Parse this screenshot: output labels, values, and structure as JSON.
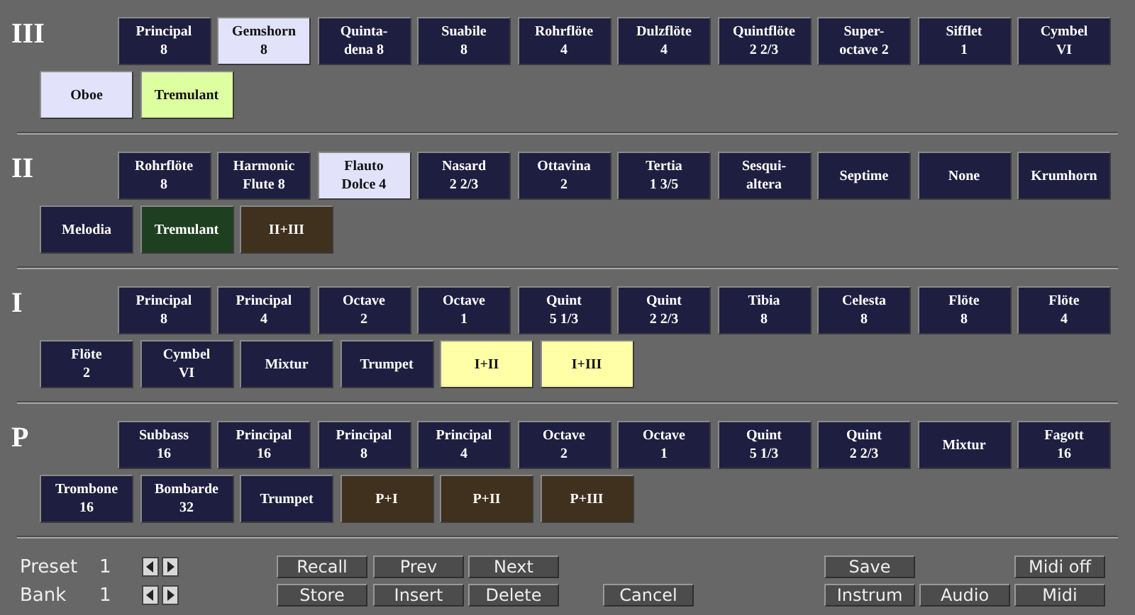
{
  "divisions": [
    {
      "name": "III",
      "stops": [
        {
          "kind": "stop",
          "label": "Principal\n8",
          "on": false
        },
        {
          "kind": "stop",
          "label": "Gemshorn\n8",
          "on": true
        },
        {
          "kind": "stop",
          "label": "Quinta-\ndena 8",
          "on": false
        },
        {
          "kind": "stop",
          "label": "Suabile\n8",
          "on": false
        },
        {
          "kind": "stop",
          "label": "Rohrflöte\n4",
          "on": false
        },
        {
          "kind": "stop",
          "label": "Dulzflöte\n4",
          "on": false
        },
        {
          "kind": "stop",
          "label": "Quintflöte\n2 2/3",
          "on": false
        },
        {
          "kind": "stop",
          "label": "Super-\noctave 2",
          "on": false
        },
        {
          "kind": "stop",
          "label": "Sifflet\n1",
          "on": false
        },
        {
          "kind": "stop",
          "label": "Cymbel\nVI",
          "on": false
        },
        {
          "kind": "stop",
          "label": "Oboe",
          "on": true
        },
        {
          "kind": "tremulant",
          "label": "Tremulant",
          "on": true
        }
      ]
    },
    {
      "name": "II",
      "stops": [
        {
          "kind": "stop",
          "label": "Rohrflöte\n8",
          "on": false
        },
        {
          "kind": "stop",
          "label": "Harmonic\nFlute 8",
          "on": false
        },
        {
          "kind": "stop",
          "label": "Flauto\nDolce 4",
          "on": true
        },
        {
          "kind": "stop",
          "label": "Nasard\n2 2/3",
          "on": false
        },
        {
          "kind": "stop",
          "label": "Ottavina\n2",
          "on": false
        },
        {
          "kind": "stop",
          "label": "Tertia\n1 3/5",
          "on": false
        },
        {
          "kind": "stop",
          "label": "Sesqui-\naltera",
          "on": false
        },
        {
          "kind": "stop",
          "label": "Septime",
          "on": false
        },
        {
          "kind": "stop",
          "label": "None",
          "on": false
        },
        {
          "kind": "stop",
          "label": "Krumhorn",
          "on": false
        },
        {
          "kind": "stop",
          "label": "Melodia",
          "on": false
        },
        {
          "kind": "tremulant",
          "label": "Tremulant",
          "on": false
        },
        {
          "kind": "coupler",
          "label": "II+III",
          "on": false
        }
      ]
    },
    {
      "name": "I",
      "stops": [
        {
          "kind": "stop",
          "label": "Principal\n8",
          "on": false
        },
        {
          "kind": "stop",
          "label": "Principal\n4",
          "on": false
        },
        {
          "kind": "stop",
          "label": "Octave\n2",
          "on": false
        },
        {
          "kind": "stop",
          "label": "Octave\n1",
          "on": false
        },
        {
          "kind": "stop",
          "label": "Quint\n5 1/3",
          "on": false
        },
        {
          "kind": "stop",
          "label": "Quint\n2 2/3",
          "on": false
        },
        {
          "kind": "stop",
          "label": "Tibia\n8",
          "on": false
        },
        {
          "kind": "stop",
          "label": "Celesta\n8",
          "on": false
        },
        {
          "kind": "stop",
          "label": "Flöte\n8",
          "on": false
        },
        {
          "kind": "stop",
          "label": "Flöte\n4",
          "on": false
        },
        {
          "kind": "stop",
          "label": "Flöte\n2",
          "on": false
        },
        {
          "kind": "stop",
          "label": "Cymbel\nVI",
          "on": false
        },
        {
          "kind": "stop",
          "label": "Mixtur",
          "on": false
        },
        {
          "kind": "stop",
          "label": "Trumpet",
          "on": false
        },
        {
          "kind": "coupler",
          "label": "I+II",
          "on": true
        },
        {
          "kind": "coupler",
          "label": "I+III",
          "on": true
        }
      ]
    },
    {
      "name": "P",
      "stops": [
        {
          "kind": "stop",
          "label": "Subbass\n16",
          "on": false
        },
        {
          "kind": "stop",
          "label": "Principal\n16",
          "on": false
        },
        {
          "kind": "stop",
          "label": "Principal\n8",
          "on": false
        },
        {
          "kind": "stop",
          "label": "Principal\n4",
          "on": false
        },
        {
          "kind": "stop",
          "label": "Octave\n2",
          "on": false
        },
        {
          "kind": "stop",
          "label": "Octave\n1",
          "on": false
        },
        {
          "kind": "stop",
          "label": "Quint\n5 1/3",
          "on": false
        },
        {
          "kind": "stop",
          "label": "Quint\n2 2/3",
          "on": false
        },
        {
          "kind": "stop",
          "label": "Mixtur",
          "on": false
        },
        {
          "kind": "stop",
          "label": "Fagott\n16",
          "on": false
        },
        {
          "kind": "stop",
          "label": "Trombone\n16",
          "on": false
        },
        {
          "kind": "stop",
          "label": "Bombarde\n32",
          "on": false
        },
        {
          "kind": "stop",
          "label": "Trumpet",
          "on": false
        },
        {
          "kind": "coupler",
          "label": "P+I",
          "on": false
        },
        {
          "kind": "coupler",
          "label": "P+II",
          "on": false
        },
        {
          "kind": "coupler",
          "label": "P+III",
          "on": false
        }
      ]
    }
  ],
  "counters": [
    {
      "label": "Preset",
      "value": "1"
    },
    {
      "label": "Bank",
      "value": "1"
    }
  ],
  "buttons": [
    "Recall",
    "Prev",
    "Next",
    "Save",
    "Midi off",
    "Store",
    "Insert",
    "Delete",
    "Cancel",
    "Instrum",
    "Audio",
    "Midi"
  ]
}
